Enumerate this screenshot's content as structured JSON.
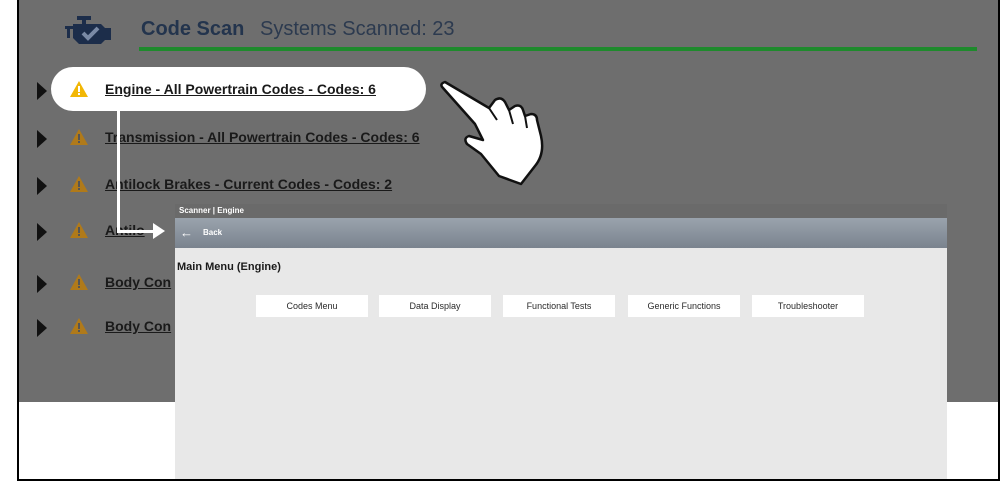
{
  "header": {
    "title": "Code Scan",
    "subtitle": "Systems Scanned: 23",
    "engine_icon": "check-engine-icon",
    "progress": 1.0,
    "accent_color": "#1e8a2c"
  },
  "systems": [
    {
      "name": "Engine - All Powertrain Codes",
      "codes_label": " - Codes: 6"
    },
    {
      "name": "Transmission - All Powertrain Codes",
      "codes_label": " - Codes: 6"
    },
    {
      "name": "Antilock Brakes - Current Codes",
      "codes_label": " - Codes: 2"
    },
    {
      "name": "Antilo",
      "codes_label": ""
    },
    {
      "name": "Body Con",
      "codes_label": ""
    },
    {
      "name": "Body Con",
      "codes_label": ""
    }
  ],
  "panel": {
    "window_title": "Scanner | Engine",
    "back_label": "Back",
    "back_icon": "left-arrow-icon",
    "heading": "Main Menu (Engine)",
    "menu_buttons": [
      "Codes Menu",
      "Data Display",
      "Functional Tests",
      "Generic Functions",
      "Troubleshooter"
    ]
  },
  "pointer_icon": "pointing-hand-icon"
}
